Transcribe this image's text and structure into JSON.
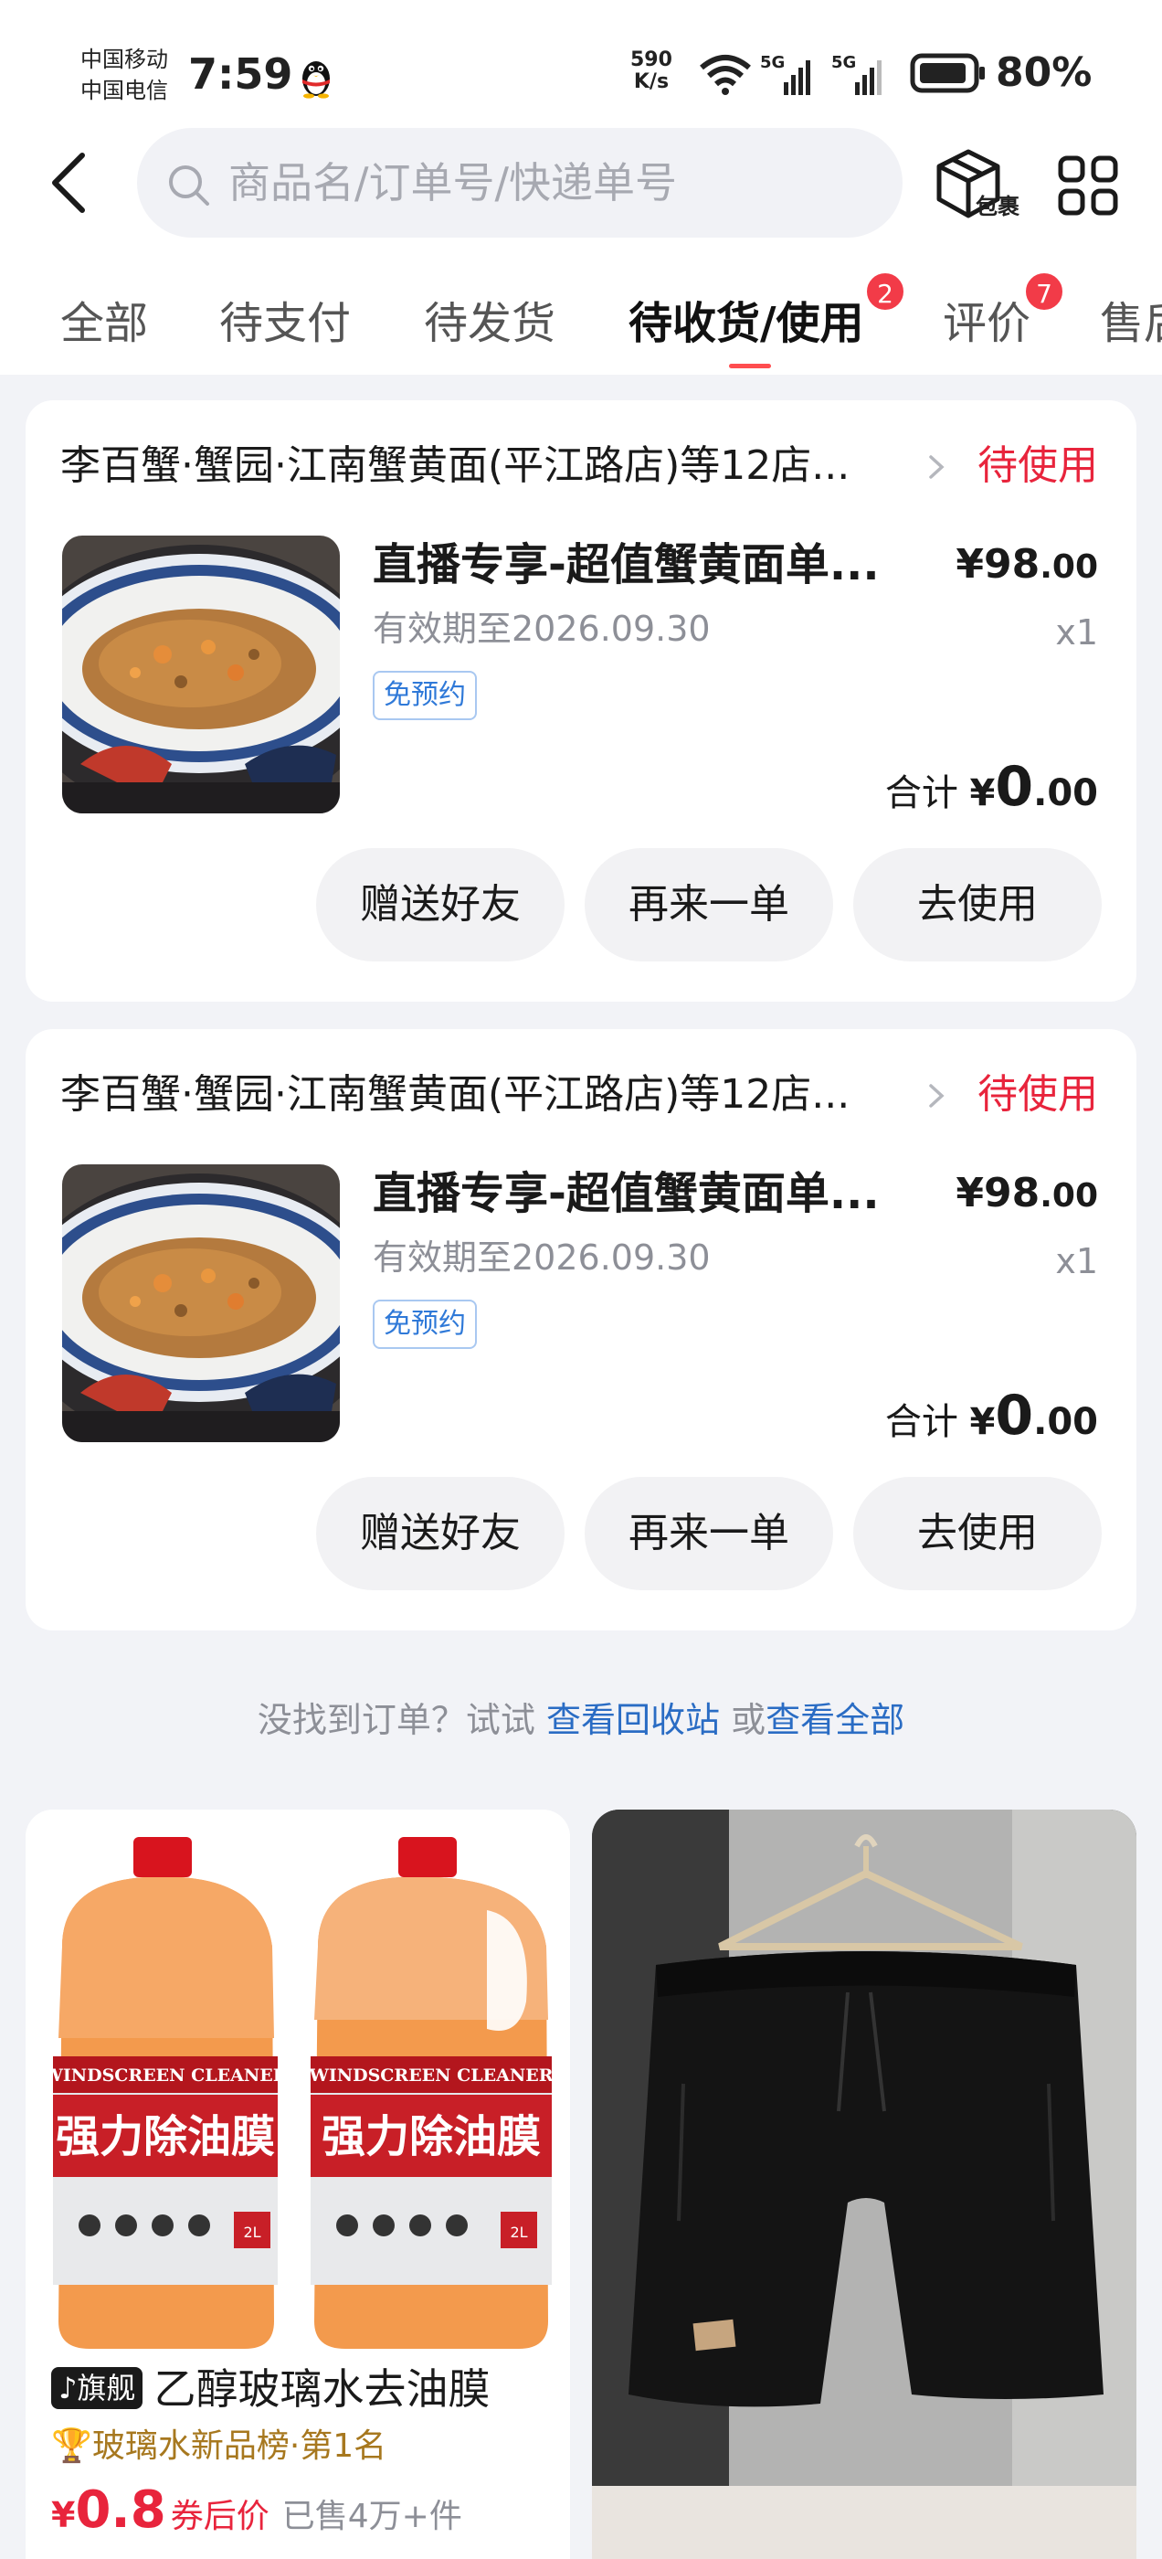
{
  "status_bar": {
    "carrier1": "中国移动",
    "carrier2": "中国电信",
    "time": "7:59",
    "net_speed_value": "590",
    "net_speed_unit": "K/s",
    "signal1": "5G",
    "signal2": "5G",
    "battery": "80%"
  },
  "header": {
    "search_placeholder": "商品名/订单号/快递单号",
    "package_label": "包裹"
  },
  "tabs": [
    {
      "label": "全部"
    },
    {
      "label": "待支付"
    },
    {
      "label": "待发货"
    },
    {
      "label": "待收货/使用",
      "badge": "2",
      "active": true
    },
    {
      "label": "评价",
      "badge": "7"
    },
    {
      "label": "售后"
    }
  ],
  "orders": [
    {
      "shop": "李百蟹·蟹园·江南蟹黄面(平江路店)等12店...",
      "status": "待使用",
      "product": "直播专享-超值蟹黄面单...",
      "price_yen": "¥",
      "price_int": "98",
      "price_dec": ".00",
      "validity": "有效期至2026.09.30",
      "qty": "x1",
      "tag": "免预约",
      "total_label": "合计",
      "total_yen": "¥",
      "total_int": "0",
      "total_dec": ".00",
      "buttons": [
        "赠送好友",
        "再来一单",
        "去使用"
      ]
    },
    {
      "shop": "李百蟹·蟹园·江南蟹黄面(平江路店)等12店...",
      "status": "待使用",
      "product": "直播专享-超值蟹黄面单...",
      "price_yen": "¥",
      "price_int": "98",
      "price_dec": ".00",
      "validity": "有效期至2026.09.30",
      "qty": "x1",
      "tag": "免预约",
      "total_label": "合计",
      "total_yen": "¥",
      "total_int": "0",
      "total_dec": ".00",
      "buttons": [
        "赠送好友",
        "再来一单",
        "去使用"
      ]
    }
  ],
  "hint": {
    "prefix": "没找到订单？试试 ",
    "link1": "查看回收站",
    "middle": " 或",
    "link2": "查看全部"
  },
  "recommendations": [
    {
      "flag": "旗舰",
      "title": "乙醇玻璃水去油膜",
      "rank": "玻璃水新品榜·第1名",
      "price_yen": "¥",
      "price": "0.8",
      "price_label": "券后价",
      "sold": "已售4万+件",
      "bottle_label_en": "WINDSCREEN CLEANER",
      "bottle_label_cn": "强力除油膜",
      "bottle_net": "2L"
    },
    {
      "image": "black-shorts-on-hanger"
    }
  ],
  "colors": {
    "accent_red": "#e8243c",
    "link_blue": "#2a6cc4",
    "badge_red": "#f23b48"
  }
}
